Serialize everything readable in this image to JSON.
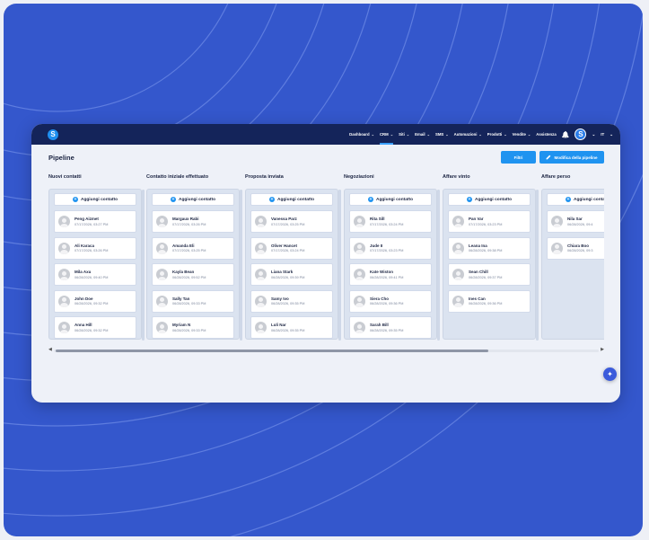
{
  "app": {
    "logo_letter": "S"
  },
  "nav": {
    "items": [
      {
        "label": "Dashboard"
      },
      {
        "label": "CRM"
      },
      {
        "label": "Siti"
      },
      {
        "label": "Email"
      },
      {
        "label": "SMS"
      },
      {
        "label": "Automazioni"
      },
      {
        "label": "Prodotti"
      },
      {
        "label": "Vendite"
      }
    ],
    "help_label": "Assistenza",
    "avatar_letter": "S",
    "language": "IT"
  },
  "page": {
    "title": "Pipeline",
    "filter_label": "Filtri",
    "edit_label": "Modifica della pipeline",
    "add_contact_label": "Aggiungi contatto"
  },
  "columns": [
    {
      "title": "Nuovi contatti",
      "cards": [
        {
          "name": "Peng Aizmet",
          "date": "07/17/2026, 03:27 PM"
        },
        {
          "name": "Ali Karaca",
          "date": "07/17/2026, 03:26 PM"
        },
        {
          "name": "Mila Axu",
          "date": "06/28/2026, 09:40 PM"
        },
        {
          "name": "John Doe",
          "date": "06/28/2026, 09:32 PM"
        },
        {
          "name": "Anna Hill",
          "date": "06/28/2026, 09:32 PM"
        }
      ]
    },
    {
      "title": "Contatto iniziale effettuato",
      "cards": [
        {
          "name": "Margaux Rabi",
          "date": "07/17/2026, 03:26 PM"
        },
        {
          "name": "Amanda Eli",
          "date": "07/17/2026, 03:25 PM"
        },
        {
          "name": "Kayla Bean",
          "date": "06/28/2026, 09:52 PM"
        },
        {
          "name": "Sally Tan",
          "date": "06/28/2026, 09:33 PM"
        },
        {
          "name": "Myriam N",
          "date": "06/28/2026, 09:33 PM"
        }
      ]
    },
    {
      "title": "Proposta inviata",
      "cards": [
        {
          "name": "Vanessa Parz",
          "date": "07/17/2026, 03:25 PM"
        },
        {
          "name": "Oliver Hancet",
          "date": "07/17/2026, 03:24 PM"
        },
        {
          "name": "Liana Stark",
          "date": "06/28/2026, 09:39 PM"
        },
        {
          "name": "Samy Ivo",
          "date": "06/28/2026, 09:35 PM"
        },
        {
          "name": "Luli Nar",
          "date": "06/28/2026, 09:35 PM"
        }
      ]
    },
    {
      "title": "Negoziazioni",
      "cards": [
        {
          "name": "Rita Sill",
          "date": "07/17/2026, 03:24 PM"
        },
        {
          "name": "Jude II",
          "date": "07/17/2026, 03:23 PM"
        },
        {
          "name": "Kate Wiston",
          "date": "06/28/2026, 09:41 PM"
        },
        {
          "name": "Siera Cho",
          "date": "06/28/2026, 09:36 PM"
        },
        {
          "name": "Sarah Bill",
          "date": "06/28/2026, 09:35 PM"
        }
      ]
    },
    {
      "title": "Affare vinto",
      "cards": [
        {
          "name": "Pan Var",
          "date": "07/17/2026, 03:23 PM"
        },
        {
          "name": "Leana Ina",
          "date": "06/28/2026, 09:38 PM"
        },
        {
          "name": "Sean Chill",
          "date": "06/28/2026, 09:37 PM"
        },
        {
          "name": "Ines Can",
          "date": "06/28/2026, 09:36 PM"
        }
      ]
    },
    {
      "title": "Affare perso",
      "cards": [
        {
          "name": "Nila Sar",
          "date": "06/28/2026, 09:4"
        },
        {
          "name": "Chiara Boo",
          "date": "06/28/2026, 09:3"
        }
      ]
    }
  ],
  "colors": {
    "background": "#3457cc",
    "topbar": "#14245a",
    "accent": "#1f93f0"
  }
}
